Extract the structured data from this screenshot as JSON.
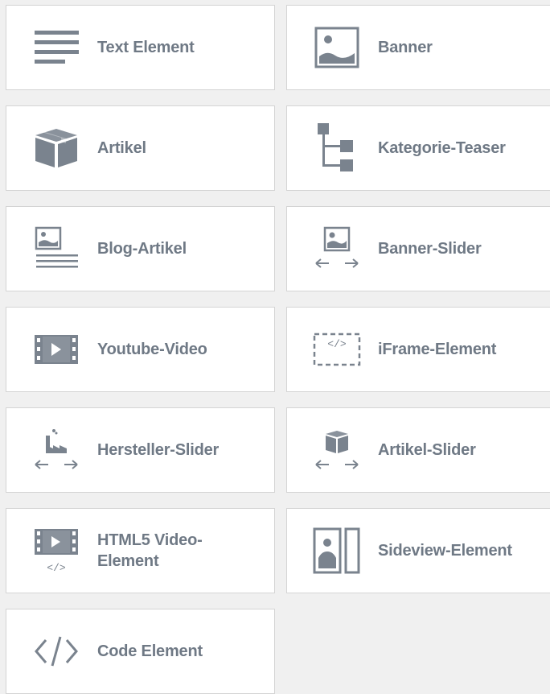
{
  "palette": {
    "icon": "#7a838e",
    "text": "#6f7985",
    "tile_bg": "#ffffff",
    "border": "#d4d4d4",
    "page_bg": "#f0f0f0"
  },
  "elements": [
    {
      "label": "Text Element",
      "icon": "text-lines-icon"
    },
    {
      "label": "Banner",
      "icon": "image-icon"
    },
    {
      "label": "Artikel",
      "icon": "box-icon"
    },
    {
      "label": "Kategorie-Teaser",
      "icon": "category-tree-icon"
    },
    {
      "label": "Blog-Artikel",
      "icon": "blog-article-icon"
    },
    {
      "label": "Banner-Slider",
      "icon": "image-slider-icon"
    },
    {
      "label": "Youtube-Video",
      "icon": "film-play-icon"
    },
    {
      "label": "iFrame-Element",
      "icon": "iframe-code-icon"
    },
    {
      "label": "Hersteller-Slider",
      "icon": "factory-slider-icon"
    },
    {
      "label": "Artikel-Slider",
      "icon": "box-slider-icon"
    },
    {
      "label": "HTML5 Video-Element",
      "icon": "film-code-icon"
    },
    {
      "label": "Sideview-Element",
      "icon": "sideview-icon"
    },
    {
      "label": "Code Element",
      "icon": "code-brackets-icon"
    }
  ]
}
